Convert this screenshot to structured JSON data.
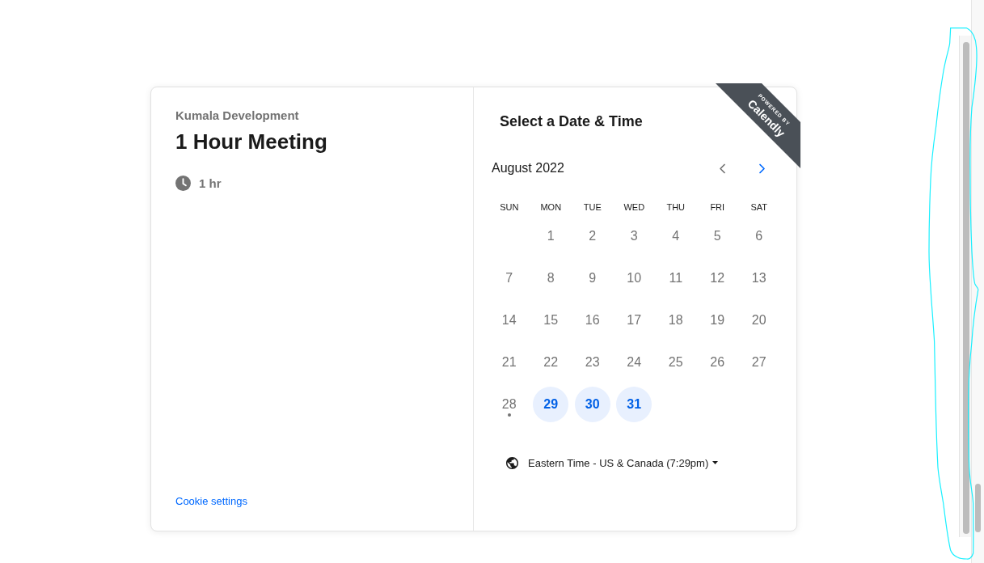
{
  "event": {
    "organizer": "Kumala Development",
    "title": "1 Hour Meeting",
    "duration": "1 hr",
    "cookie_link": "Cookie settings"
  },
  "scheduler": {
    "heading": "Select a Date & Time",
    "month": "August 2022",
    "nav": [
      {
        "kind": "prev",
        "disabled": true
      },
      {
        "kind": "next",
        "disabled": false
      }
    ],
    "weekdays": [
      "SUN",
      "MON",
      "TUE",
      "WED",
      "THU",
      "FRI",
      "SAT"
    ],
    "days": [
      {
        "kind": "blank"
      },
      {
        "kind": "day",
        "label": "1",
        "available": false,
        "today": false
      },
      {
        "kind": "day",
        "label": "2",
        "available": false,
        "today": false
      },
      {
        "kind": "day",
        "label": "3",
        "available": false,
        "today": false
      },
      {
        "kind": "day",
        "label": "4",
        "available": false,
        "today": false
      },
      {
        "kind": "day",
        "label": "5",
        "available": false,
        "today": false
      },
      {
        "kind": "day",
        "label": "6",
        "available": false,
        "today": false
      },
      {
        "kind": "day",
        "label": "7",
        "available": false,
        "today": false
      },
      {
        "kind": "day",
        "label": "8",
        "available": false,
        "today": false
      },
      {
        "kind": "day",
        "label": "9",
        "available": false,
        "today": false
      },
      {
        "kind": "day",
        "label": "10",
        "available": false,
        "today": false
      },
      {
        "kind": "day",
        "label": "11",
        "available": false,
        "today": false
      },
      {
        "kind": "day",
        "label": "12",
        "available": false,
        "today": false
      },
      {
        "kind": "day",
        "label": "13",
        "available": false,
        "today": false
      },
      {
        "kind": "day",
        "label": "14",
        "available": false,
        "today": false
      },
      {
        "kind": "day",
        "label": "15",
        "available": false,
        "today": false
      },
      {
        "kind": "day",
        "label": "16",
        "available": false,
        "today": false
      },
      {
        "kind": "day",
        "label": "17",
        "available": false,
        "today": false
      },
      {
        "kind": "day",
        "label": "18",
        "available": false,
        "today": false
      },
      {
        "kind": "day",
        "label": "19",
        "available": false,
        "today": false
      },
      {
        "kind": "day",
        "label": "20",
        "available": false,
        "today": false
      },
      {
        "kind": "day",
        "label": "21",
        "available": false,
        "today": false
      },
      {
        "kind": "day",
        "label": "22",
        "available": false,
        "today": false
      },
      {
        "kind": "day",
        "label": "23",
        "available": false,
        "today": false
      },
      {
        "kind": "day",
        "label": "24",
        "available": false,
        "today": false
      },
      {
        "kind": "day",
        "label": "25",
        "available": false,
        "today": false
      },
      {
        "kind": "day",
        "label": "26",
        "available": false,
        "today": false
      },
      {
        "kind": "day",
        "label": "27",
        "available": false,
        "today": false
      },
      {
        "kind": "day",
        "label": "28",
        "available": false,
        "today": true
      },
      {
        "kind": "day",
        "label": "29",
        "available": true,
        "today": false
      },
      {
        "kind": "day",
        "label": "30",
        "available": true,
        "today": false
      },
      {
        "kind": "day",
        "label": "31",
        "available": true,
        "today": false
      }
    ],
    "timezone": "Eastern Time - US & Canada (7:29pm)"
  },
  "badge": {
    "line_1": "POWERED BY",
    "brand": "Calendly"
  }
}
